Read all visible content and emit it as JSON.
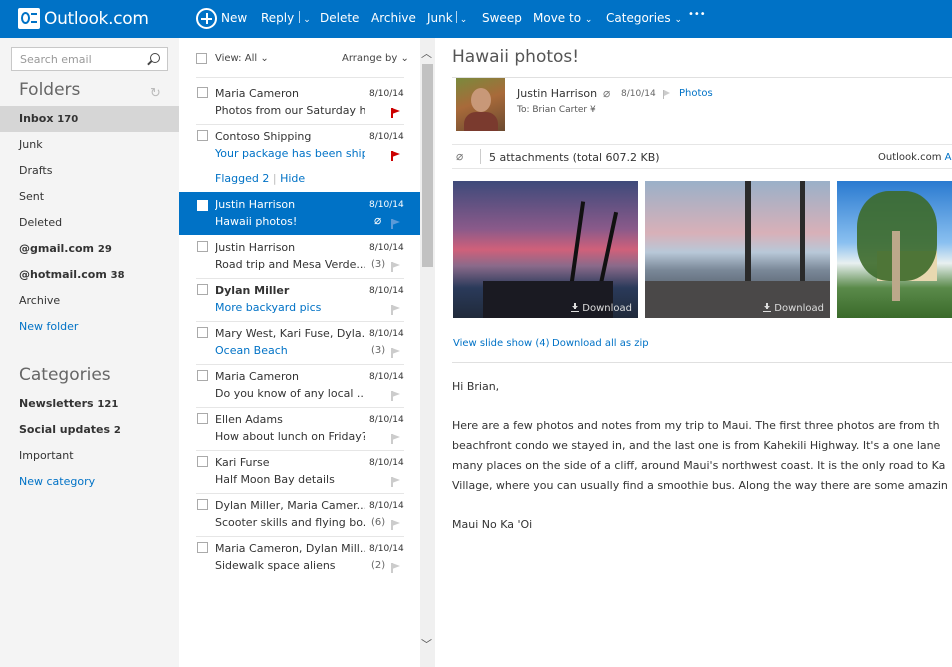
{
  "brand": {
    "name": "Outlook.com"
  },
  "toolbar": {
    "new": "New",
    "reply": "Reply",
    "delete": "Delete",
    "archive": "Archive",
    "junk": "Junk",
    "sweep": "Sweep",
    "move_to": "Move to",
    "categories": "Categories",
    "more": "•••"
  },
  "sidebar": {
    "search_placeholder": "Search email",
    "folders_heading": "Folders",
    "folders": [
      {
        "label": "Inbox",
        "count": "170"
      },
      {
        "label": "Junk",
        "count": ""
      },
      {
        "label": "Drafts",
        "count": ""
      },
      {
        "label": "Sent",
        "count": ""
      },
      {
        "label": "Deleted",
        "count": ""
      },
      {
        "label": "@gmail.com",
        "count": "29"
      },
      {
        "label": "@hotmail.com",
        "count": "38"
      },
      {
        "label": "Archive",
        "count": ""
      }
    ],
    "new_folder": "New folder",
    "categories_heading": "Categories",
    "categories": [
      {
        "label": "Newsletters",
        "count": "121"
      },
      {
        "label": "Social updates",
        "count": "2"
      },
      {
        "label": "Important",
        "count": ""
      }
    ],
    "new_category": "New category"
  },
  "list": {
    "view": "View: All",
    "arrange": "Arrange by",
    "flagged_label": "Flagged 2",
    "flagged_hide": "Hide",
    "messages": [
      {
        "sender": "Maria Cameron",
        "date": "8/10/14",
        "subject": "Photos from our Saturday h...",
        "count": "",
        "flag": "red"
      },
      {
        "sender": "Contoso Shipping",
        "date": "8/10/14",
        "subject": "Your package has been ship...",
        "count": "",
        "flag": "red"
      },
      {
        "sender": "Justin Harrison",
        "date": "8/10/14",
        "subject": "Hawaii photos!",
        "count": "",
        "flag": "grey"
      },
      {
        "sender": "Justin Harrison",
        "date": "8/10/14",
        "subject": "Road trip and Mesa Verde...",
        "count": "(3)",
        "flag": "grey"
      },
      {
        "sender": "Dylan Miller",
        "date": "8/10/14",
        "subject": "More backyard pics",
        "count": "",
        "flag": "grey"
      },
      {
        "sender": "Mary West, Kari Fuse, Dyla...",
        "date": "8/10/14",
        "subject": "Ocean Beach",
        "count": "(3)",
        "flag": "grey"
      },
      {
        "sender": "Maria Cameron",
        "date": "8/10/14",
        "subject": "Do you know of any local ...",
        "count": "",
        "flag": "grey"
      },
      {
        "sender": "Ellen Adams",
        "date": "8/10/14",
        "subject": "How about lunch on Friday?",
        "count": "",
        "flag": "grey"
      },
      {
        "sender": "Kari Furse",
        "date": "8/10/14",
        "subject": "Half Moon Bay details",
        "count": "",
        "flag": "grey"
      },
      {
        "sender": "Dylan Miller, Maria Camer...",
        "date": "8/10/14",
        "subject": "Scooter skills and flying bo...",
        "count": "(6)",
        "flag": "grey"
      },
      {
        "sender": "Maria Cameron, Dylan Mill...",
        "date": "8/10/14",
        "subject": "Sidewalk space aliens",
        "count": "(2)",
        "flag": "grey"
      }
    ]
  },
  "reading": {
    "subject": "Hawaii photos!",
    "sender": "Justin Harrison",
    "date": "8/10/14",
    "category": "Photos",
    "to": "To: Brian Carter",
    "attachments": "5 attachments (total 607.2 KB)",
    "attachments_source": "Outlook.com",
    "attachments_source_link": "Ac",
    "download": "Download",
    "slideshow": "View slide show (4)",
    "download_all": "Download all as zip",
    "greeting": "Hi Brian,",
    "body": [
      "Here are a few photos and notes from my trip to Maui. The first three photos are from th",
      "beachfront condo we stayed in, and the last one is from Kahekili Highway. It's a one lane",
      "many places on the side of a cliff, around Maui's northwest coast. It is the only road to Ka",
      "Village, where you can usually find a smoothie bus. Along the way there are some amazin"
    ],
    "signoff": "Maui No Ka 'Oi"
  },
  "colors": {
    "accent": "#0072c6",
    "flag_red": "#cc0000",
    "sidebar_bg": "#f4f4f4"
  }
}
